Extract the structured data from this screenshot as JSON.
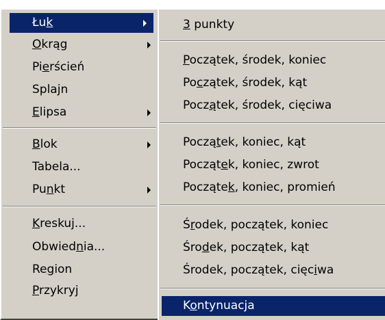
{
  "menu_main": {
    "items": [
      {
        "label": "Łuk",
        "mnemonic_index": 2,
        "submenu": true,
        "selected": true
      },
      {
        "label": "Okrąg",
        "mnemonic_index": 0,
        "submenu": true
      },
      {
        "label": "Pierścień",
        "mnemonic_index": 2,
        "submenu": false
      },
      {
        "label": "Splajn",
        "mnemonic_index": 4,
        "submenu": false
      },
      {
        "label": "Elipsa",
        "mnemonic_index": 0,
        "submenu": true
      },
      {
        "label": "Blok",
        "mnemonic_index": 0,
        "submenu": true
      },
      {
        "label": "Tabela...",
        "mnemonic_index": -1,
        "submenu": false
      },
      {
        "label": "Punkt",
        "mnemonic_index": 2,
        "submenu": true
      },
      {
        "label": "Kreskuj...",
        "mnemonic_index": 0,
        "submenu": false
      },
      {
        "label": "Obwiednia...",
        "mnemonic_index": 6,
        "submenu": false
      },
      {
        "label": "Region",
        "mnemonic_index": 2,
        "submenu": false
      },
      {
        "label": "Przykryj",
        "mnemonic_index": 0,
        "submenu": false
      }
    ]
  },
  "menu_sub": {
    "items": [
      {
        "label": "3 punkty",
        "mnemonic_index": 0
      },
      {
        "label": "Początek, środek, koniec",
        "mnemonic_index": 0
      },
      {
        "label": "Początek, środek, kąt",
        "mnemonic_index": 2
      },
      {
        "label": "Początek, środek, cięciwa",
        "mnemonic_index": 4
      },
      {
        "label": "Początek, koniec, kąt",
        "mnemonic_index": 5
      },
      {
        "label": "Początek, koniec, zwrot",
        "mnemonic_index": 6
      },
      {
        "label": "Początek, koniec, promień",
        "mnemonic_index": 7
      },
      {
        "label": "Środek, początek, koniec",
        "mnemonic_index": 1
      },
      {
        "label": "Środek, początek, kąt",
        "mnemonic_index": 3
      },
      {
        "label": "Środek, początek, cięciwa",
        "mnemonic_index": 22
      },
      {
        "label": "Kontynuacja",
        "mnemonic_index": 1,
        "selected": true
      }
    ]
  }
}
